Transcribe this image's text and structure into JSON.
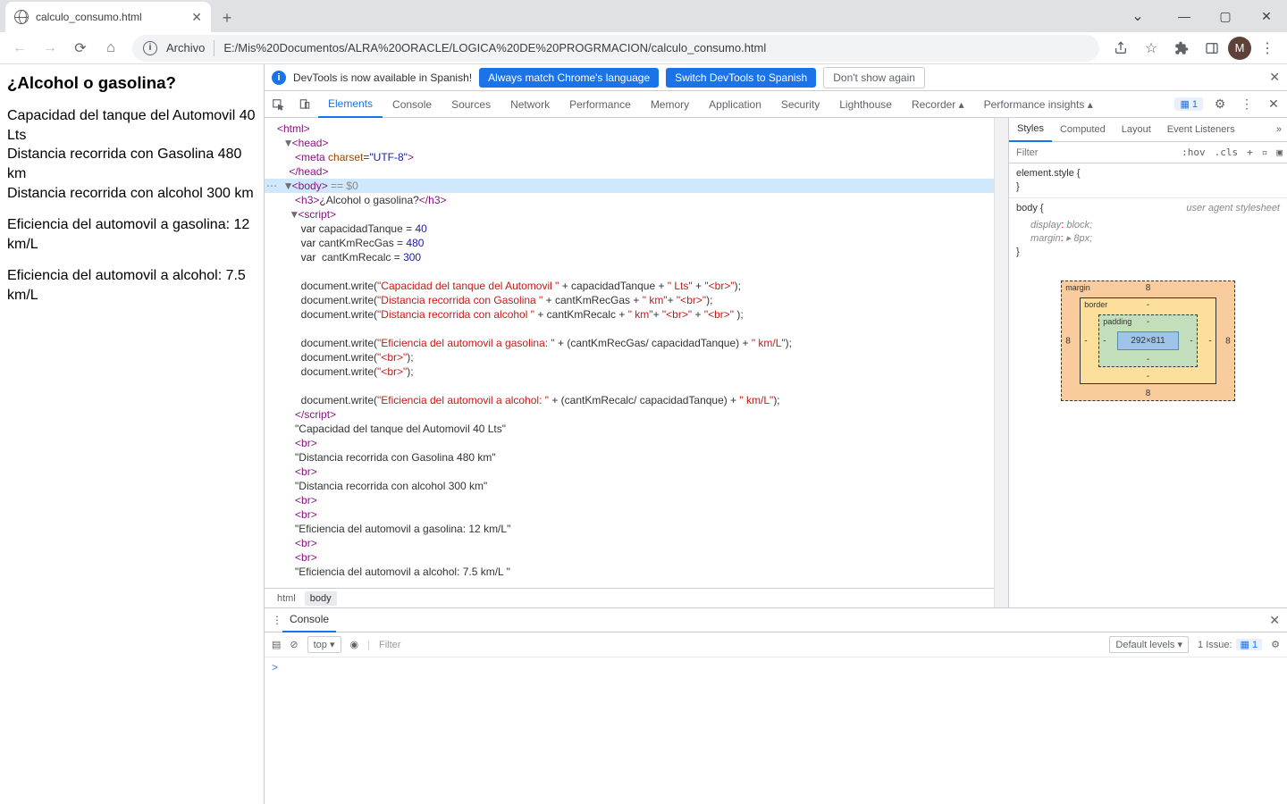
{
  "browser": {
    "tab_title": "calculo_consumo.html",
    "url_label": "Archivo",
    "url": "E:/Mis%20Documentos/ALRA%20ORACLE/LOGICA%20DE%20PROGRMACION/calculo_consumo.html",
    "avatar_letter": "M"
  },
  "page_content": {
    "heading": "¿Alcohol o gasolina?",
    "l1": "Capacidad del tanque del Automovil 40 Lts",
    "l2": "Distancia recorrida con Gasolina 480 km",
    "l3": "Distancia recorrida con alcohol 300 km",
    "l4": "Eficiencia del automovil a gasolina: 12 km/L",
    "l5": "Eficiencia del automovil a alcohol: 7.5 km/L"
  },
  "infobar": {
    "msg": "DevTools is now available in Spanish!",
    "btn1": "Always match Chrome's language",
    "btn2": "Switch DevTools to Spanish",
    "btn3": "Don't show again"
  },
  "devtools_tabs": [
    "Elements",
    "Console",
    "Sources",
    "Network",
    "Performance",
    "Memory",
    "Application",
    "Security",
    "Lighthouse",
    "Recorder ▴",
    "Performance insights ▴"
  ],
  "devtools_active_tab": "Elements",
  "issues_badge": "1",
  "elements_tree": {
    "selected_suffix": " == $0",
    "vars": {
      "cap": "40",
      "gas": "480",
      "alc": "300"
    },
    "strings": {
      "s1": "\"Capacidad del tanque del Automovil \"",
      "s2": "\" Lts\"",
      "s3": "\"<br>\"",
      "s4": "\"Distancia recorrida con Gasolina \"",
      "s5": "\" km\"",
      "s6": "\"Distancia recorrida con alcohol \"",
      "s7": "\"Eficiencia del automovil a gasolina: \"",
      "s8": "\" km/L\"",
      "s9": "\"Eficiencia del automovil a alcohol: \"",
      "t1": "\"Capacidad del tanque del Automovil 40 Lts\"",
      "t2": "\"Distancia recorrida con Gasolina 480 km\"",
      "t3": "\"Distancia recorrida con alcohol 300 km\"",
      "t4": "\"Eficiencia del automovil a gasolina: 12 km/L\"",
      "t5": "\"Eficiencia del automovil a alcohol: 7.5 km/L \""
    }
  },
  "breadcrumbs": [
    "html",
    "body"
  ],
  "styles": {
    "tabs": [
      "Styles",
      "Computed",
      "Layout",
      "Event Listeners"
    ],
    "filter_placeholder": "Filter",
    "hov": ":hov",
    "cls": ".cls",
    "element_style": "element.style {",
    "body_sel": "body {",
    "uas": "user agent stylesheet",
    "p1": "display",
    "v1": "block;",
    "p2": "margin",
    "v2": "▸ 8px;",
    "box": {
      "margin": "margin",
      "border": "border",
      "padding": "padding",
      "content": "292×811",
      "m": "8",
      "dash": "-"
    }
  },
  "console": {
    "label": "Console",
    "top": "top ▾",
    "filter": "Filter",
    "levels": "Default levels ▾",
    "issue": "1 Issue:",
    "issue_badge": "1",
    "prompt": ">"
  }
}
